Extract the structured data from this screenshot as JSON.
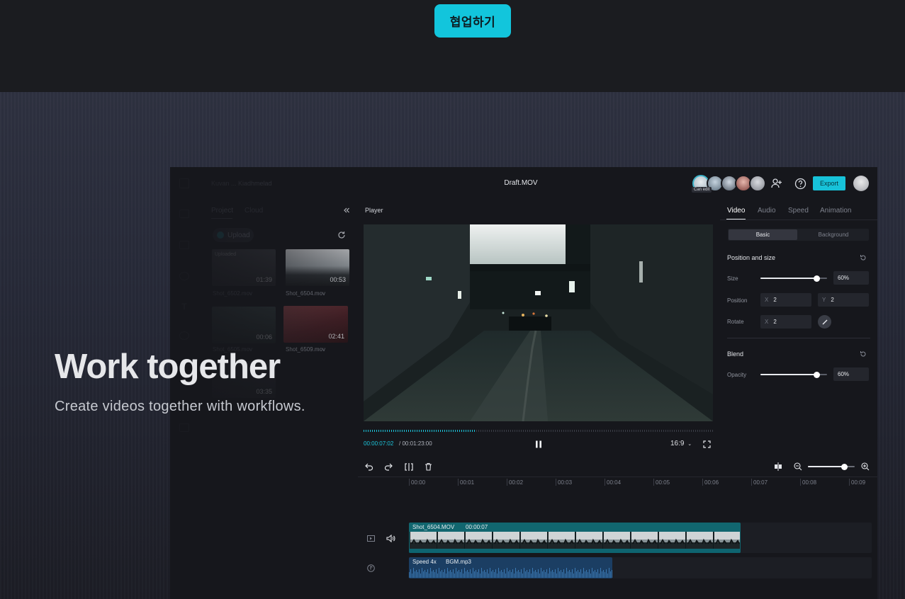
{
  "header": {
    "collab_button": "협업하기"
  },
  "hero": {
    "title": "Work together",
    "subtitle": "Create videos together with workflows."
  },
  "editor": {
    "document_title": "Draft.MOV",
    "project_name": "Kuvan ... Kiadhmelad",
    "collaborators": {
      "can_edit_label": "Can edit"
    },
    "export_label": "Export",
    "media_panel": {
      "tabs": [
        "Project",
        "Cloud"
      ],
      "upload_label": "Upload",
      "uploaded_label": "Uploaded",
      "items": [
        {
          "name": "Shot_6502.mov",
          "duration": "01:39"
        },
        {
          "name": "Shot_6504.mov",
          "duration": "00:53"
        },
        {
          "name": "Shot_6505.mov",
          "duration": "00:06"
        },
        {
          "name": "Shot_6509.mov",
          "duration": "02:41"
        },
        {
          "name": "",
          "duration": "03:35"
        }
      ]
    },
    "player": {
      "label": "Player",
      "current_time": "00:00:07:02",
      "total_time": "/ 00:01:23:00",
      "aspect_ratio": "16:9",
      "progress": 0.32
    },
    "inspector": {
      "tabs": [
        "Video",
        "Audio",
        "Speed",
        "Animation"
      ],
      "active_tab": "Video",
      "subtabs": [
        "Basic",
        "Background"
      ],
      "position_size": {
        "title": "Position and size",
        "size_label": "Size",
        "size_value": "60%",
        "size_level": 0.83,
        "position_label": "Position",
        "x_axis": "X",
        "x_value": "2",
        "y_axis": "Y",
        "y_value": "2",
        "rotate_label": "Rotate",
        "rotate_axis": "X",
        "rotate_value": "2"
      },
      "blend": {
        "title": "Blend",
        "opacity_label": "Opacity",
        "opacity_value": "60%",
        "opacity_level": 0.83
      }
    },
    "timeline": {
      "ruler": [
        "00:00",
        "00:01",
        "00:02",
        "00:03",
        "00:04",
        "00:05",
        "00:06",
        "00:07",
        "00:08",
        "00:09"
      ],
      "zoom_level": 0.8,
      "video_clip": {
        "name": "Shot_6504.MOV",
        "duration": "00:00:07"
      },
      "audio_clip": {
        "speed": "Speed 4x",
        "name": "BGM.mp3"
      }
    }
  }
}
